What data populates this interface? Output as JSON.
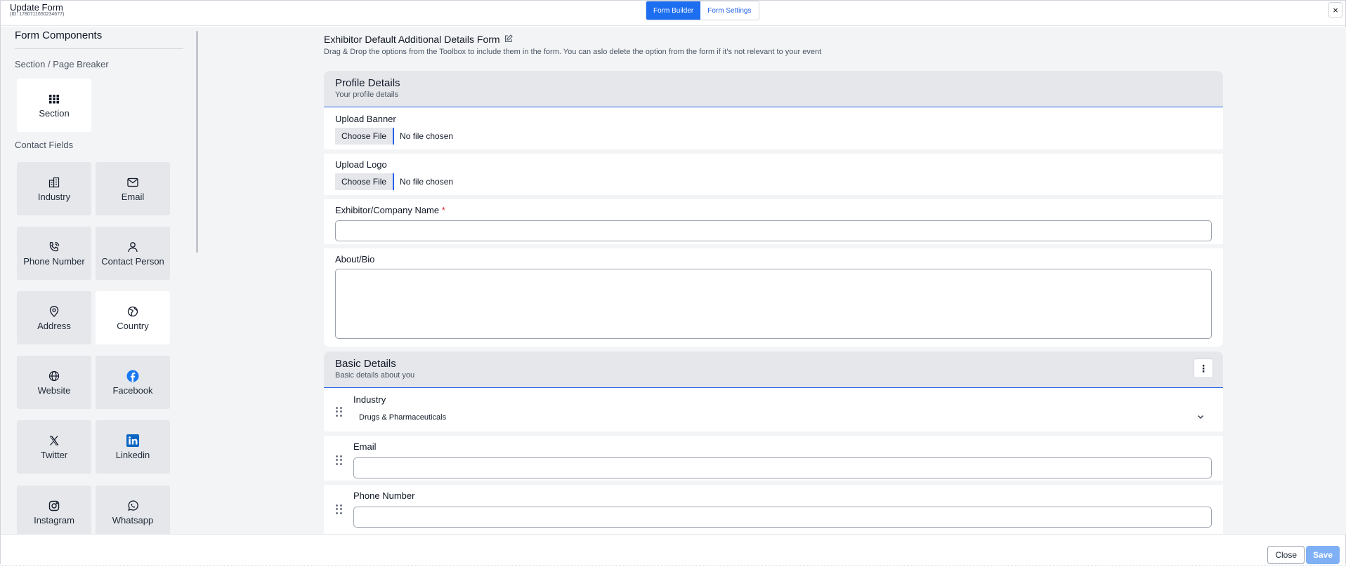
{
  "header": {
    "title": "Update Form",
    "subid": "(ID: 1780711650234677)",
    "tabs": [
      {
        "label": "Form Builder"
      },
      {
        "label": "Form Settings"
      }
    ],
    "close_glyph": "×"
  },
  "sidebar": {
    "title": "Form Components",
    "section_label": "Section / Page Breaker",
    "section_tile": {
      "label": "Section",
      "icon": "grid-icon"
    },
    "contact_label": "Contact Fields",
    "tiles": [
      {
        "label": "Industry",
        "icon": "building-icon"
      },
      {
        "label": "Email",
        "icon": "envelope-icon"
      },
      {
        "label": "Phone Number",
        "icon": "phone-icon"
      },
      {
        "label": "Contact Person",
        "icon": "person-icon"
      },
      {
        "label": "Address",
        "icon": "map-pin-icon"
      },
      {
        "label": "Country",
        "icon": "globe-pin-icon"
      },
      {
        "label": "Website",
        "icon": "globe-icon"
      },
      {
        "label": "Facebook",
        "icon": "facebook-icon"
      },
      {
        "label": "Twitter",
        "icon": "x-icon"
      },
      {
        "label": "Linkedin",
        "icon": "linkedin-icon"
      },
      {
        "label": "Instagram",
        "icon": "instagram-icon"
      },
      {
        "label": "Whatsapp",
        "icon": "whatsapp-icon"
      }
    ]
  },
  "form": {
    "title": "Exhibitor Default Additional Details Form",
    "description": "Drag & Drop the options from the Toolbox to include them in the form. You can aslo delete the option from the form if it's not relevant to your event"
  },
  "profile": {
    "heading": "Profile Details",
    "subheading": "Your profile details",
    "upload_banner_label": "Upload Banner",
    "upload_logo_label": "Upload Logo",
    "choose_file": "Choose File",
    "no_file": "No file chosen",
    "company_label": "Exhibitor/Company Name",
    "required_mark": "*",
    "about_label": "About/Bio"
  },
  "basic": {
    "heading": "Basic Details",
    "subheading": "Basic details about you",
    "kebab_glyph": "⋮",
    "industry_label": "Industry",
    "industry_value": "Drugs & Pharmaceuticals",
    "email_label": "Email",
    "phone_label": "Phone Number"
  },
  "footer": {
    "close_label": "Close",
    "save_label": "Save"
  },
  "colors": {
    "accent": "#1d6ef0",
    "panel": "#f3f4f6",
    "tile": "#e5e7eb",
    "save_disabled": "#7fb0f5",
    "required": "#dc2626",
    "facebook": "#1877f2",
    "linkedin": "#0a66c2"
  }
}
